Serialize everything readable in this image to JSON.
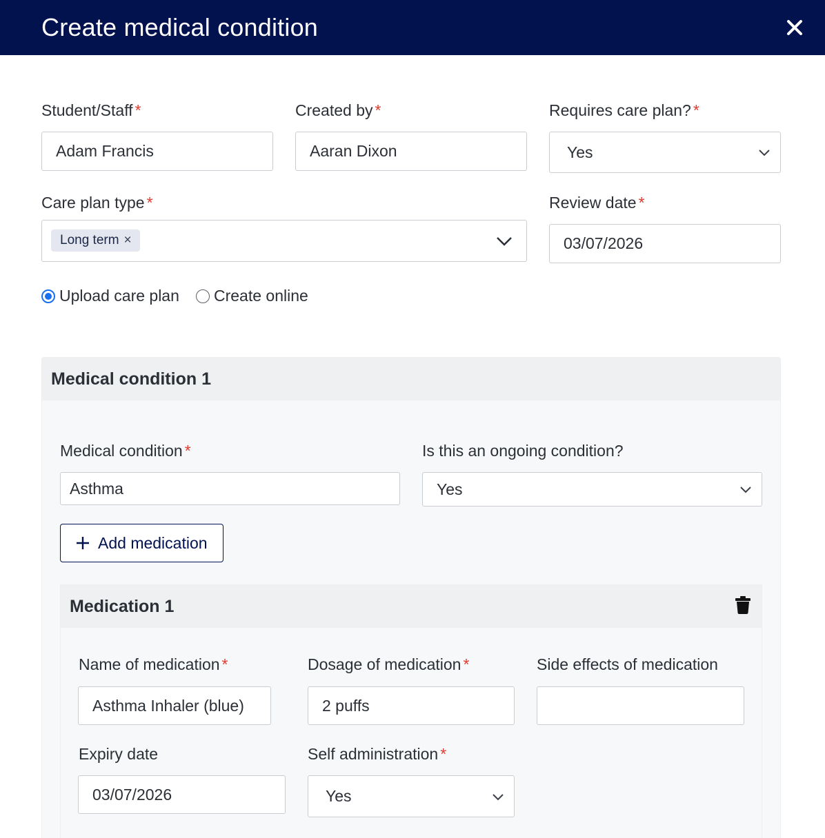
{
  "dialog": {
    "title": "Create medical condition",
    "close_label": "close"
  },
  "form": {
    "student_staff": {
      "label": "Student/Staff",
      "required": "*",
      "value": "Adam Francis"
    },
    "created_by": {
      "label": "Created by",
      "required": "*",
      "value": "Aaran Dixon"
    },
    "requires_care_plan": {
      "label": "Requires care plan?",
      "required": "*",
      "value": "Yes"
    },
    "care_plan_type": {
      "label": "Care plan type",
      "required": "*",
      "tags": [
        "Long term"
      ],
      "tag_remove": "×"
    },
    "review_date": {
      "label": "Review date",
      "required": "*",
      "value": "03/07/2026"
    },
    "care_plan_mode": {
      "options": [
        "Upload care plan",
        "Create online"
      ],
      "selected": "Upload care plan"
    }
  },
  "conditions": [
    {
      "title": "Medical condition 1",
      "condition": {
        "label": "Medical condition",
        "required": "*",
        "value": "Asthma"
      },
      "ongoing": {
        "label": "Is this an ongoing condition?",
        "value": "Yes"
      },
      "add_medication_label": "Add medication",
      "medications": [
        {
          "title": "Medication 1",
          "name": {
            "label": "Name of medication",
            "required": "*",
            "value": "Asthma Inhaler (blue)"
          },
          "dosage": {
            "label": "Dosage of medication",
            "required": "*",
            "value": "2 puffs"
          },
          "side_effects": {
            "label": "Side effects of medication",
            "value": ""
          },
          "expiry": {
            "label": "Expiry date",
            "value": "03/07/2026"
          },
          "self_admin": {
            "label": "Self administration",
            "required": "*",
            "value": "Yes"
          }
        }
      ]
    }
  ],
  "icons": {
    "close": "close-icon",
    "chevron": "chevron-down-icon",
    "plus": "plus-icon",
    "trash": "trash-icon"
  },
  "colors": {
    "header_bg": "#02124f",
    "required": "#e23a2e",
    "radio_accent": "#1a6ff0"
  }
}
